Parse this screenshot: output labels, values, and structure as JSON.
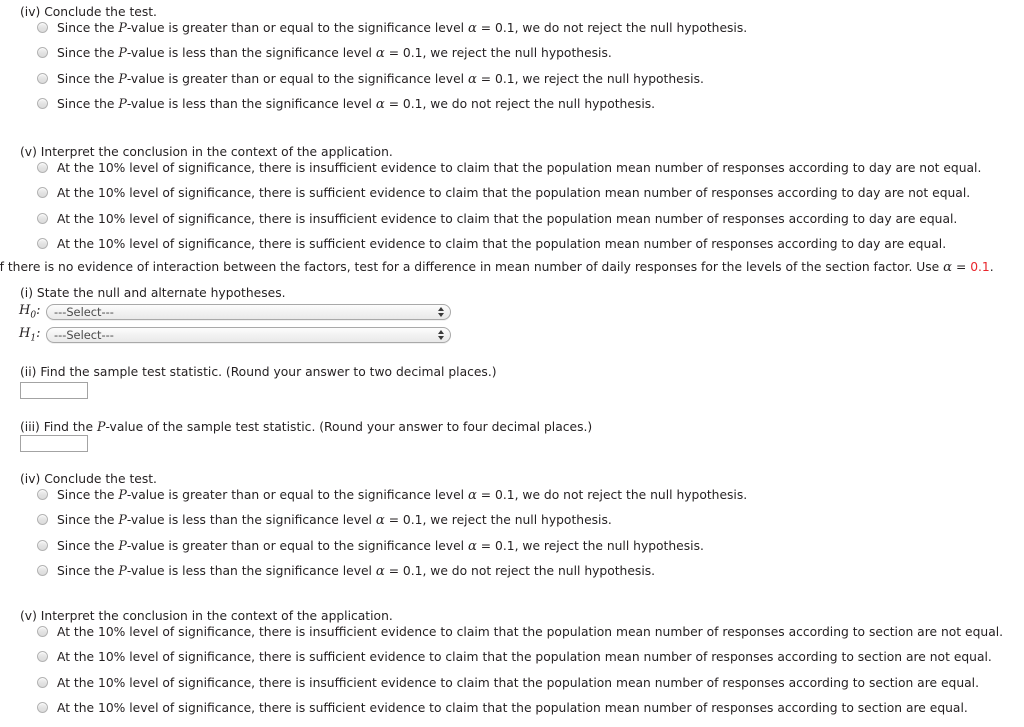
{
  "colors": {
    "text": "#231f20",
    "accent_red": "#e8262c",
    "input_border": "#a3a3a3"
  },
  "sections": {
    "day_conclude": {
      "heading": "(iv) Conclude the test.",
      "options": [
        {
          "lead": "Since the ",
          "pvar": "P",
          "mid": "-value is greater than or equal to the significance level ",
          "alpha": "α",
          "eq": " = 0.1, we do not reject the null hypothesis."
        },
        {
          "lead": "Since the ",
          "pvar": "P",
          "mid": "-value is less than the significance level ",
          "alpha": "α",
          "eq": " = 0.1, we reject the null hypothesis."
        },
        {
          "lead": "Since the ",
          "pvar": "P",
          "mid": "-value is greater than or equal to the significance level ",
          "alpha": "α",
          "eq": " = 0.1, we reject the null hypothesis."
        },
        {
          "lead": "Since the ",
          "pvar": "P",
          "mid": "-value is less than the significance level ",
          "alpha": "α",
          "eq": " = 0.1, we do not reject the null hypothesis."
        }
      ]
    },
    "day_interpret": {
      "heading": "(v) Interpret the conclusion in the context of the application.",
      "options": [
        {
          "text": "At the 10% level of significance, there is insufficient evidence to claim that the population mean number of responses according to day are not equal."
        },
        {
          "text": "At the 10% level of significance, there is sufficient evidence to claim that the population mean number of responses according to day are not equal."
        },
        {
          "text": "At the 10% level of significance, there is insufficient evidence to claim that the population mean number of responses according to day are equal."
        },
        {
          "text": "At the 10% level of significance, there is sufficient evidence to claim that the population mean number of responses according to day are equal."
        }
      ]
    },
    "intro": {
      "before": "If there is no evidence of interaction between the factors, test for a difference in mean number of daily responses for the levels of the section factor. Use ",
      "alpha": "α",
      "equals": " = ",
      "value": "0.1",
      "after": "."
    },
    "hypotheses": {
      "heading": "(i) State the null and alternate hypotheses.",
      "rows": [
        {
          "label": "H",
          "subscript": "0",
          "colon": ":",
          "selected": "---Select---"
        },
        {
          "label": "H",
          "subscript": "1",
          "colon": ":",
          "selected": "---Select---"
        }
      ]
    },
    "statistic": {
      "heading": "(ii) Find the sample test statistic. (Round your answer to two decimal places.)",
      "value": "",
      "placeholder": ""
    },
    "pvalue": {
      "heading_before": "(iii) Find the ",
      "heading_pvar": "P",
      "heading_after": "-value of the sample test statistic. (Round your answer to four decimal places.)",
      "value": "",
      "placeholder": ""
    },
    "section_conclude": {
      "heading": "(iv) Conclude the test.",
      "options": [
        {
          "lead": "Since the ",
          "pvar": "P",
          "mid": "-value is greater than or equal to the significance level ",
          "alpha": "α",
          "eq": " = 0.1, we do not reject the null hypothesis."
        },
        {
          "lead": "Since the ",
          "pvar": "P",
          "mid": "-value is less than the significance level ",
          "alpha": "α",
          "eq": " = 0.1, we reject the null hypothesis."
        },
        {
          "lead": "Since the ",
          "pvar": "P",
          "mid": "-value is greater than or equal to the significance level ",
          "alpha": "α",
          "eq": " = 0.1, we reject the null hypothesis."
        },
        {
          "lead": "Since the ",
          "pvar": "P",
          "mid": "-value is less than the significance level ",
          "alpha": "α",
          "eq": " = 0.1, we do not reject the null hypothesis."
        }
      ]
    },
    "section_interpret": {
      "heading": "(v) Interpret the conclusion in the context of the application.",
      "options": [
        {
          "text": "At the 10% level of significance, there is insufficient evidence to claim that the population mean number of responses according to section are not equal."
        },
        {
          "text": "At the 10% level of significance, there is sufficient evidence to claim that the population mean number of responses according to section are not equal."
        },
        {
          "text": "At the 10% level of significance, there is insufficient evidence to claim that the population mean number of responses according to section are equal."
        },
        {
          "text": "At the 10% level of significance, there is sufficient evidence to claim that the population mean number of responses according to section are equal."
        }
      ]
    }
  }
}
